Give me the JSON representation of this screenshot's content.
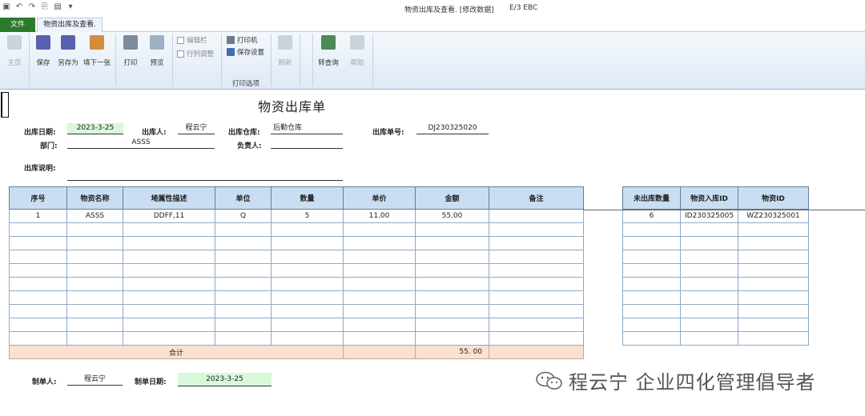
{
  "window": {
    "title": "物资出库及查看. [修改数据]",
    "extra": "E/3 EBC"
  },
  "tabs": {
    "file": "文件",
    "doc": "物资出库及查看."
  },
  "ribbon": {
    "home": "主页",
    "save": "保存",
    "save_as": "另存为",
    "fill_next": "填下一张",
    "print": "打印",
    "preview": "预览",
    "edit_bar": "编辑栏",
    "row_col_adjust": "行列调整",
    "printer": "打印机",
    "save_settings": "保存设置",
    "print_options": "打印选项",
    "refresh": "刷新",
    "to_query": "转查询",
    "help": "帮助"
  },
  "form": {
    "title": "物资出库单",
    "date_label": "出库日期:",
    "date_value": "2023-3-25",
    "person_label": "出库人:",
    "person_value": "程云宁",
    "warehouse_label": "出库仓库:",
    "warehouse_value": "后勤仓库",
    "order_label": "出库单号:",
    "order_value": "DJ230325020",
    "dept_label": "部门:",
    "dept_value": "ASSS",
    "manager_label": "负责人:",
    "manager_value": "",
    "note_label": "出库说明:",
    "note_value": ""
  },
  "main_table": {
    "headers": [
      "序号",
      "物资名称",
      "埼属性描述",
      "单位",
      "数量",
      "单价",
      "金额",
      "备注"
    ],
    "rows": [
      [
        "1",
        "ASSS",
        "DDFF,11",
        "Q",
        "5",
        "11.00",
        "55.00",
        ""
      ]
    ],
    "total_label": "合计",
    "total_amount": "55. 00"
  },
  "side_table": {
    "headers": [
      "未出库数量",
      "物资入库ID",
      "物资ID"
    ],
    "rows": [
      [
        "6",
        "ID230325005",
        "WZ230325001"
      ]
    ]
  },
  "footer": {
    "maker_label": "制单人:",
    "maker_value": "程云宁",
    "make_date_label": "制单日期:",
    "make_date_value": "2023-3-25"
  },
  "watermark": "程云宁 企业四化管理倡导者"
}
